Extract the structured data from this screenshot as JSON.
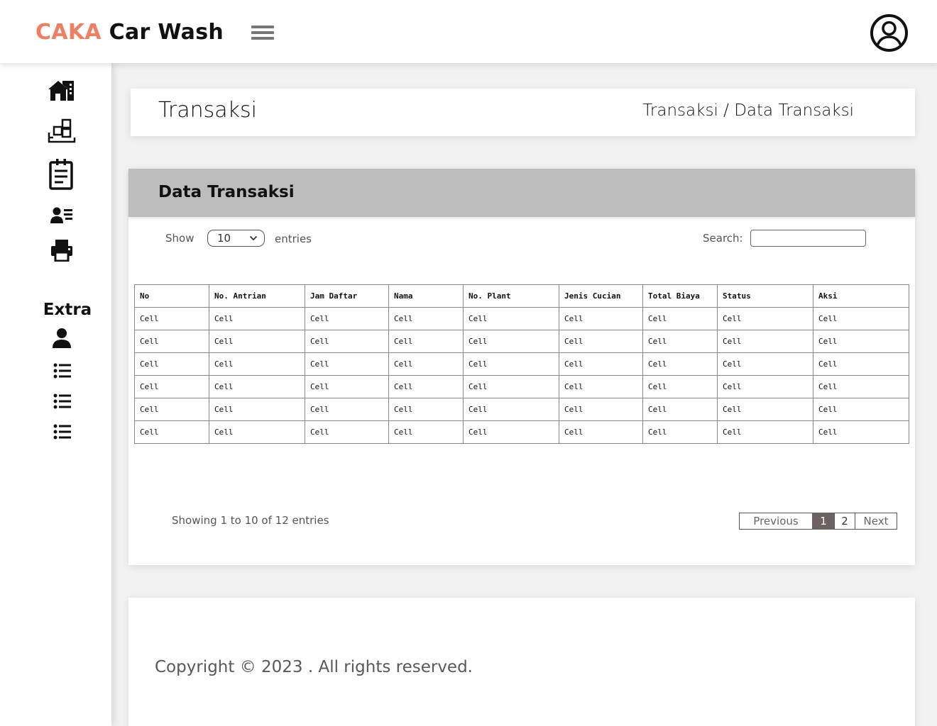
{
  "brand": {
    "accent": "CAKA",
    "rest": " Car Wash",
    "accent_color": "#ee7f63"
  },
  "header": {
    "menu_icon": "hamburger-menu-icon",
    "profile_icon": "user-circle-icon"
  },
  "sidebar": {
    "items": [
      {
        "icon": "home-building-icon"
      },
      {
        "icon": "boxes-icon"
      },
      {
        "icon": "clipboard-list-icon"
      },
      {
        "icon": "user-list-icon"
      },
      {
        "icon": "printer-icon"
      }
    ],
    "extra_label": "Extra",
    "extra_items": [
      {
        "icon": "user-icon"
      },
      {
        "icon": "list-icon"
      },
      {
        "icon": "list-icon"
      },
      {
        "icon": "list-icon"
      }
    ]
  },
  "page": {
    "title": "Transaksi",
    "breadcrumb": "Transaksi / Data Transaksi"
  },
  "table_card": {
    "heading": "Data Transaksi",
    "show_label": "Show",
    "page_size": "10",
    "entries_label": "entries",
    "search_label": "Search:",
    "search_value": "",
    "columns": [
      "No",
      "No. Antrian",
      "Jam Daftar",
      "Nama",
      "No. Plant",
      "Jenis Cucian",
      "Total Biaya",
      "Status",
      "Aksi"
    ],
    "rows": [
      [
        "Cell",
        "Cell",
        "Cell",
        "Cell",
        "Cell",
        "Cell",
        "Cell",
        "Cell",
        "Cell"
      ],
      [
        "Cell",
        "Cell",
        "Cell",
        "Cell",
        "Cell",
        "Cell",
        "Cell",
        "Cell",
        "Cell"
      ],
      [
        "Cell",
        "Cell",
        "Cell",
        "Cell",
        "Cell",
        "Cell",
        "Cell",
        "Cell",
        "Cell"
      ],
      [
        "Cell",
        "Cell",
        "Cell",
        "Cell",
        "Cell",
        "Cell",
        "Cell",
        "Cell",
        "Cell"
      ],
      [
        "Cell",
        "Cell",
        "Cell",
        "Cell",
        "Cell",
        "Cell",
        "Cell",
        "Cell",
        "Cell"
      ],
      [
        "Cell",
        "Cell",
        "Cell",
        "Cell",
        "Cell",
        "Cell",
        "Cell",
        "Cell",
        "Cell"
      ]
    ],
    "info": "Showing 1 to 10 of 12 entries",
    "pagination": {
      "previous": "Previous",
      "pages": [
        "1",
        "2"
      ],
      "current": "1",
      "next": "Next"
    }
  },
  "footer": {
    "copyright": "Copyright © 2023 . All rights reserved."
  }
}
